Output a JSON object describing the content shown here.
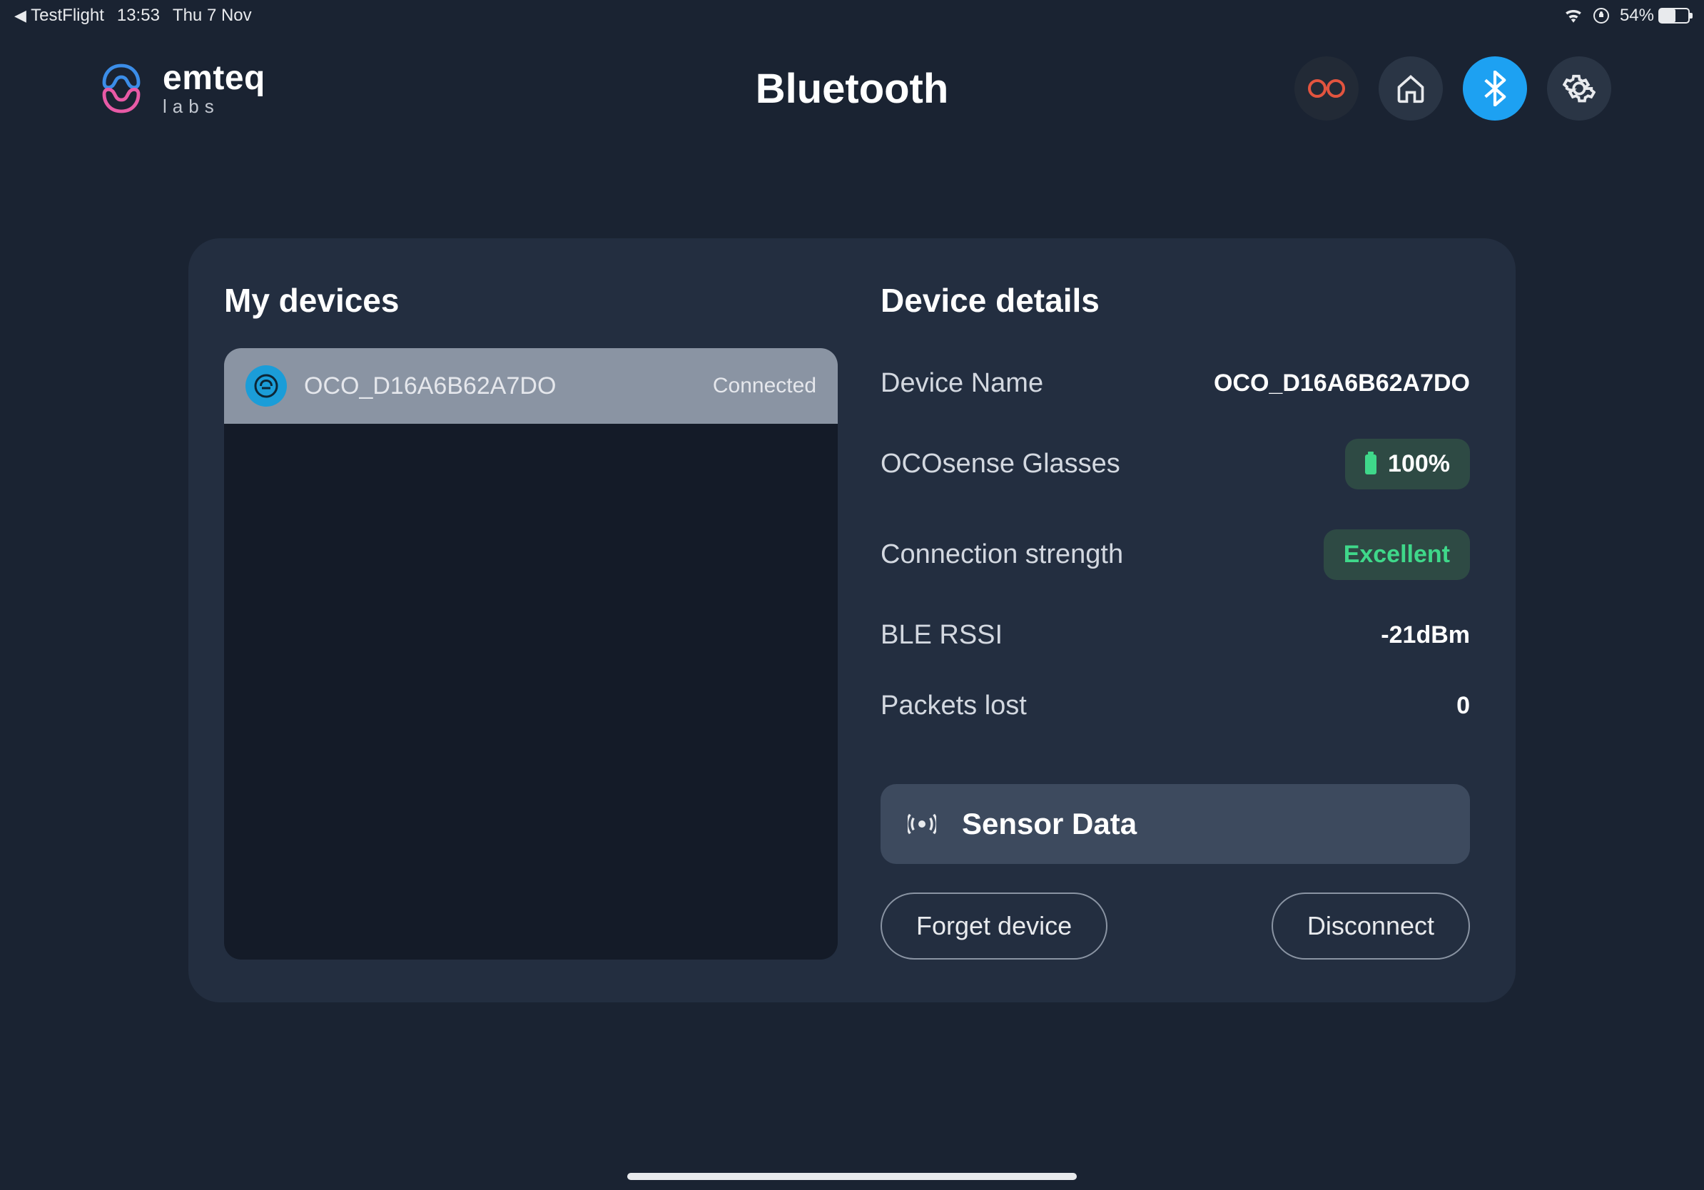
{
  "status_bar": {
    "back_app": "TestFlight",
    "time": "13:53",
    "date": "Thu 7 Nov",
    "battery_percent": "54%"
  },
  "brand": {
    "name": "emteq",
    "sub": "labs"
  },
  "page_title": "Bluetooth",
  "my_devices": {
    "title": "My devices",
    "items": [
      {
        "name": "OCO_D16A6B62A7DO",
        "status": "Connected"
      }
    ]
  },
  "details": {
    "title": "Device details",
    "rows": {
      "device_name": {
        "label": "Device Name",
        "value": "OCO_D16A6B62A7DO"
      },
      "product": {
        "label": "OCOsense Glasses",
        "value": "100%"
      },
      "connection": {
        "label": "Connection strength",
        "value": "Excellent"
      },
      "rssi": {
        "label": "BLE RSSI",
        "value": "-21dBm"
      },
      "packets": {
        "label": "Packets lost",
        "value": "0"
      }
    },
    "sensor_button": "Sensor Data",
    "forget_button": "Forget device",
    "disconnect_button": "Disconnect"
  }
}
